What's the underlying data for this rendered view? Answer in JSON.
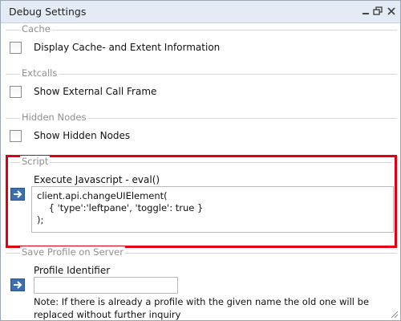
{
  "window": {
    "title": "Debug Settings"
  },
  "sections": {
    "cache": {
      "legend": "Cache",
      "checkbox_label": "Display Cache- and Extent Information",
      "checked": false
    },
    "extcalls": {
      "legend": "Extcalls",
      "checkbox_label": "Show External Call Frame",
      "checked": false
    },
    "hidden_nodes": {
      "legend": "Hidden Nodes",
      "checkbox_label": "Show Hidden Nodes",
      "checked": false
    },
    "script": {
      "legend": "Script",
      "field_label": "Execute Javascript - eval()",
      "code": "client.api.changeUIElement(\n    { 'type':'leftpane', 'toggle': true }\n);",
      "highlight_color": "#e00012"
    },
    "profile": {
      "legend": "Save Profile on Server",
      "field_label": "Profile Identifier",
      "value": "",
      "note": "Note: If there is already a profile with the given name the old one will be replaced without further inquiry"
    }
  },
  "colors": {
    "accent_button": "#3b6fb4",
    "titlebar": "#e4ebf4"
  },
  "icons": {
    "execute_button": "arrow-right-icon",
    "minimize": "minimize-icon",
    "restore": "restore-icon",
    "close": "close-icon",
    "resize": "resize-grip-icon"
  }
}
